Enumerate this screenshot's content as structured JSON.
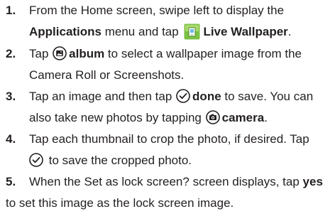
{
  "steps": [
    {
      "number": "1.",
      "text_a": "From the Home screen, swipe left to display the",
      "bold_b": "Applications",
      "text_c": " menu and tap ",
      "bold_d": "Live Wallpaper",
      "text_e": ".",
      "icon": "live-wallpaper-app-icon"
    },
    {
      "number": "2.",
      "text_a": "Tap ",
      "bold_b": "album",
      "text_c": " to select a wallpaper image from the",
      "text_d": "Camera Roll or Screenshots.",
      "icon": "album-icon"
    },
    {
      "number": "3.",
      "text_a": "Tap an image and then tap ",
      "bold_b": "done",
      "text_c": " to save. You can",
      "text_d": "also take new photos by tapping ",
      "bold_e": "camera",
      "text_f": ".",
      "icons": [
        "checkmark-circle-icon",
        "camera-icon"
      ]
    },
    {
      "number": "4.",
      "text_a": "Tap each thumbnail to crop the photo, if desired. Tap",
      "text_b": " to save the cropped photo.",
      "icon": "checkmark-circle-icon"
    },
    {
      "number": "5.",
      "text_a": "When the Set as lock screen? screen displays, tap ",
      "bold_b": "yes",
      "text_c": "to set this image as the lock screen image."
    }
  ],
  "colors": {
    "text": "#231f20",
    "icon_green": "#7ac143"
  }
}
